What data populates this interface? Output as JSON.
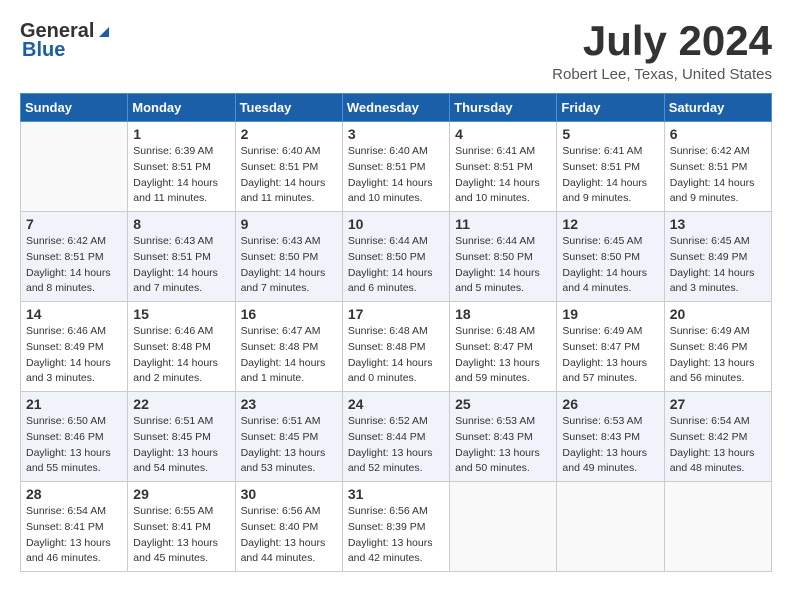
{
  "header": {
    "logo_general": "General",
    "logo_blue": "Blue",
    "month_title": "July 2024",
    "location": "Robert Lee, Texas, United States"
  },
  "weekdays": [
    "Sunday",
    "Monday",
    "Tuesday",
    "Wednesday",
    "Thursday",
    "Friday",
    "Saturday"
  ],
  "weeks": [
    [
      {
        "day": "",
        "sunrise": "",
        "sunset": "",
        "daylight": ""
      },
      {
        "day": "1",
        "sunrise": "Sunrise: 6:39 AM",
        "sunset": "Sunset: 8:51 PM",
        "daylight": "Daylight: 14 hours and 11 minutes."
      },
      {
        "day": "2",
        "sunrise": "Sunrise: 6:40 AM",
        "sunset": "Sunset: 8:51 PM",
        "daylight": "Daylight: 14 hours and 11 minutes."
      },
      {
        "day": "3",
        "sunrise": "Sunrise: 6:40 AM",
        "sunset": "Sunset: 8:51 PM",
        "daylight": "Daylight: 14 hours and 10 minutes."
      },
      {
        "day": "4",
        "sunrise": "Sunrise: 6:41 AM",
        "sunset": "Sunset: 8:51 PM",
        "daylight": "Daylight: 14 hours and 10 minutes."
      },
      {
        "day": "5",
        "sunrise": "Sunrise: 6:41 AM",
        "sunset": "Sunset: 8:51 PM",
        "daylight": "Daylight: 14 hours and 9 minutes."
      },
      {
        "day": "6",
        "sunrise": "Sunrise: 6:42 AM",
        "sunset": "Sunset: 8:51 PM",
        "daylight": "Daylight: 14 hours and 9 minutes."
      }
    ],
    [
      {
        "day": "7",
        "sunrise": "Sunrise: 6:42 AM",
        "sunset": "Sunset: 8:51 PM",
        "daylight": "Daylight: 14 hours and 8 minutes."
      },
      {
        "day": "8",
        "sunrise": "Sunrise: 6:43 AM",
        "sunset": "Sunset: 8:51 PM",
        "daylight": "Daylight: 14 hours and 7 minutes."
      },
      {
        "day": "9",
        "sunrise": "Sunrise: 6:43 AM",
        "sunset": "Sunset: 8:50 PM",
        "daylight": "Daylight: 14 hours and 7 minutes."
      },
      {
        "day": "10",
        "sunrise": "Sunrise: 6:44 AM",
        "sunset": "Sunset: 8:50 PM",
        "daylight": "Daylight: 14 hours and 6 minutes."
      },
      {
        "day": "11",
        "sunrise": "Sunrise: 6:44 AM",
        "sunset": "Sunset: 8:50 PM",
        "daylight": "Daylight: 14 hours and 5 minutes."
      },
      {
        "day": "12",
        "sunrise": "Sunrise: 6:45 AM",
        "sunset": "Sunset: 8:50 PM",
        "daylight": "Daylight: 14 hours and 4 minutes."
      },
      {
        "day": "13",
        "sunrise": "Sunrise: 6:45 AM",
        "sunset": "Sunset: 8:49 PM",
        "daylight": "Daylight: 14 hours and 3 minutes."
      }
    ],
    [
      {
        "day": "14",
        "sunrise": "Sunrise: 6:46 AM",
        "sunset": "Sunset: 8:49 PM",
        "daylight": "Daylight: 14 hours and 3 minutes."
      },
      {
        "day": "15",
        "sunrise": "Sunrise: 6:46 AM",
        "sunset": "Sunset: 8:48 PM",
        "daylight": "Daylight: 14 hours and 2 minutes."
      },
      {
        "day": "16",
        "sunrise": "Sunrise: 6:47 AM",
        "sunset": "Sunset: 8:48 PM",
        "daylight": "Daylight: 14 hours and 1 minute."
      },
      {
        "day": "17",
        "sunrise": "Sunrise: 6:48 AM",
        "sunset": "Sunset: 8:48 PM",
        "daylight": "Daylight: 14 hours and 0 minutes."
      },
      {
        "day": "18",
        "sunrise": "Sunrise: 6:48 AM",
        "sunset": "Sunset: 8:47 PM",
        "daylight": "Daylight: 13 hours and 59 minutes."
      },
      {
        "day": "19",
        "sunrise": "Sunrise: 6:49 AM",
        "sunset": "Sunset: 8:47 PM",
        "daylight": "Daylight: 13 hours and 57 minutes."
      },
      {
        "day": "20",
        "sunrise": "Sunrise: 6:49 AM",
        "sunset": "Sunset: 8:46 PM",
        "daylight": "Daylight: 13 hours and 56 minutes."
      }
    ],
    [
      {
        "day": "21",
        "sunrise": "Sunrise: 6:50 AM",
        "sunset": "Sunset: 8:46 PM",
        "daylight": "Daylight: 13 hours and 55 minutes."
      },
      {
        "day": "22",
        "sunrise": "Sunrise: 6:51 AM",
        "sunset": "Sunset: 8:45 PM",
        "daylight": "Daylight: 13 hours and 54 minutes."
      },
      {
        "day": "23",
        "sunrise": "Sunrise: 6:51 AM",
        "sunset": "Sunset: 8:45 PM",
        "daylight": "Daylight: 13 hours and 53 minutes."
      },
      {
        "day": "24",
        "sunrise": "Sunrise: 6:52 AM",
        "sunset": "Sunset: 8:44 PM",
        "daylight": "Daylight: 13 hours and 52 minutes."
      },
      {
        "day": "25",
        "sunrise": "Sunrise: 6:53 AM",
        "sunset": "Sunset: 8:43 PM",
        "daylight": "Daylight: 13 hours and 50 minutes."
      },
      {
        "day": "26",
        "sunrise": "Sunrise: 6:53 AM",
        "sunset": "Sunset: 8:43 PM",
        "daylight": "Daylight: 13 hours and 49 minutes."
      },
      {
        "day": "27",
        "sunrise": "Sunrise: 6:54 AM",
        "sunset": "Sunset: 8:42 PM",
        "daylight": "Daylight: 13 hours and 48 minutes."
      }
    ],
    [
      {
        "day": "28",
        "sunrise": "Sunrise: 6:54 AM",
        "sunset": "Sunset: 8:41 PM",
        "daylight": "Daylight: 13 hours and 46 minutes."
      },
      {
        "day": "29",
        "sunrise": "Sunrise: 6:55 AM",
        "sunset": "Sunset: 8:41 PM",
        "daylight": "Daylight: 13 hours and 45 minutes."
      },
      {
        "day": "30",
        "sunrise": "Sunrise: 6:56 AM",
        "sunset": "Sunset: 8:40 PM",
        "daylight": "Daylight: 13 hours and 44 minutes."
      },
      {
        "day": "31",
        "sunrise": "Sunrise: 6:56 AM",
        "sunset": "Sunset: 8:39 PM",
        "daylight": "Daylight: 13 hours and 42 minutes."
      },
      {
        "day": "",
        "sunrise": "",
        "sunset": "",
        "daylight": ""
      },
      {
        "day": "",
        "sunrise": "",
        "sunset": "",
        "daylight": ""
      },
      {
        "day": "",
        "sunrise": "",
        "sunset": "",
        "daylight": ""
      }
    ]
  ]
}
